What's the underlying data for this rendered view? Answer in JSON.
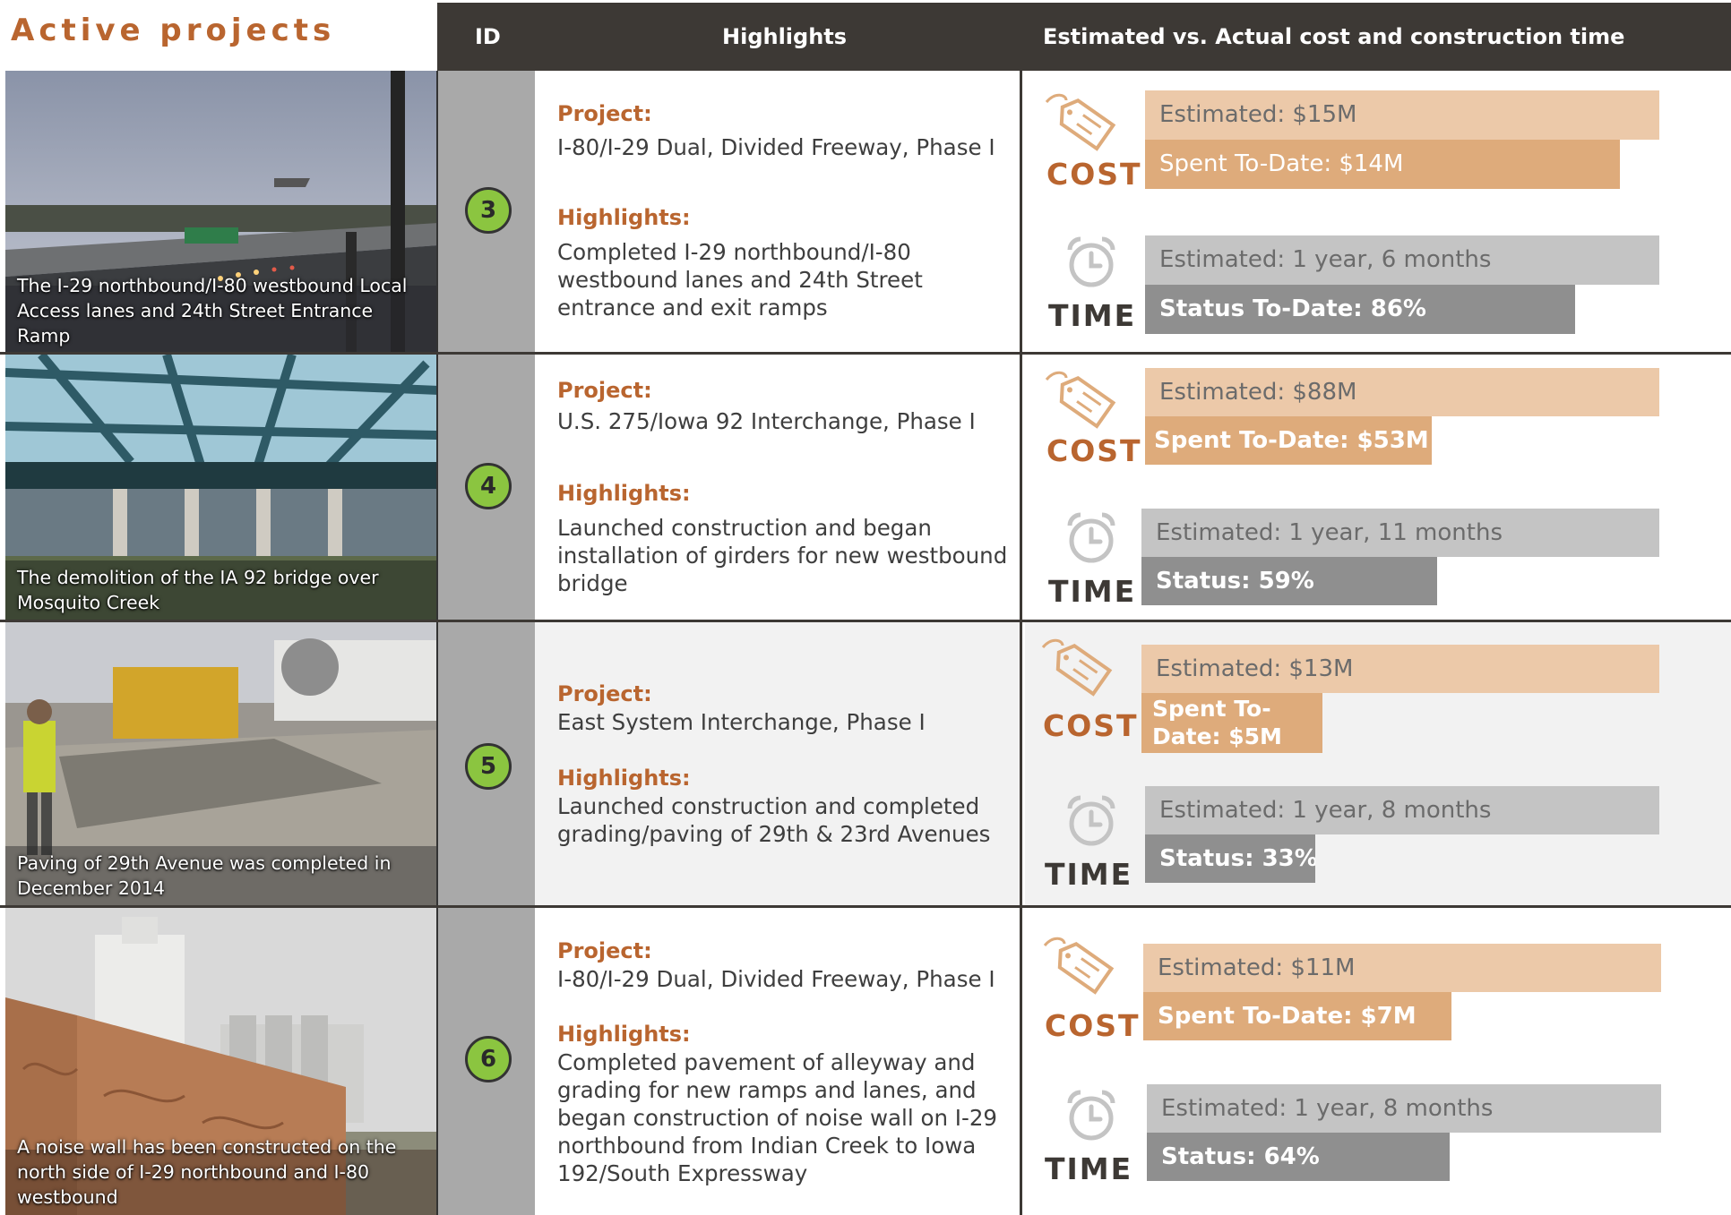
{
  "page_title": "Active projects",
  "header": {
    "id": "ID",
    "highlights": "Highlights",
    "estimated": "Estimated vs. Actual cost and construction time"
  },
  "labels": {
    "project": "Project:",
    "highlights": "Highlights:",
    "cost": "COST",
    "time": "TIME"
  },
  "rows": [
    {
      "id": "3",
      "caption": "The I-29 northbound/I-80 westbound Local Access lanes and 24th Street Entrance Ramp",
      "project": "I-80/I-29 Dual, Divided Freeway, Phase I",
      "highlights": "Completed I-29 northbound/I-80 westbound lanes and 24th Street entrance and exit ramps",
      "est_cost": "Estimated: $15M",
      "spent": "Spent To-Date: $14M",
      "est_time": "Estimated: 1 year, 6 months",
      "status": "Status To-Date: 86%"
    },
    {
      "id": "4",
      "caption": "The demolition of the IA 92 bridge over Mosquito Creek",
      "project": "U.S. 275/Iowa 92 Interchange, Phase I",
      "highlights": "Launched construction and began installation of girders for new westbound bridge",
      "est_cost": "Estimated: $88M",
      "spent": "Spent To-Date: $53M",
      "est_time": "Estimated: 1 year, 11 months",
      "status": "Status: 59%"
    },
    {
      "id": "5",
      "caption": "Paving of 29th Avenue was completed in December 2014",
      "project": "East System Interchange, Phase I",
      "highlights": "Launched construction and completed grading/paving of 29th & 23rd Avenues",
      "est_cost": "Estimated: $13M",
      "spent": "Spent To-Date: $5M",
      "est_time": "Estimated: 1 year, 8 months",
      "status": "Status: 33%"
    },
    {
      "id": "6",
      "caption": "A noise wall has been constructed on the north side of I-29 northbound and I-80 westbound",
      "project": "I-80/I-29 Dual, Divided Freeway, Phase I",
      "highlights": "Completed pavement of alleyway and grading for new ramps and lanes, and began construction of noise wall on I-29 northbound from Indian Creek to Iowa 192/South Expressway",
      "est_cost": "Estimated: $11M",
      "spent": "Spent To-Date: $7M",
      "est_time": "Estimated: 1 year, 8 months",
      "status": "Status: 64%"
    }
  ]
}
